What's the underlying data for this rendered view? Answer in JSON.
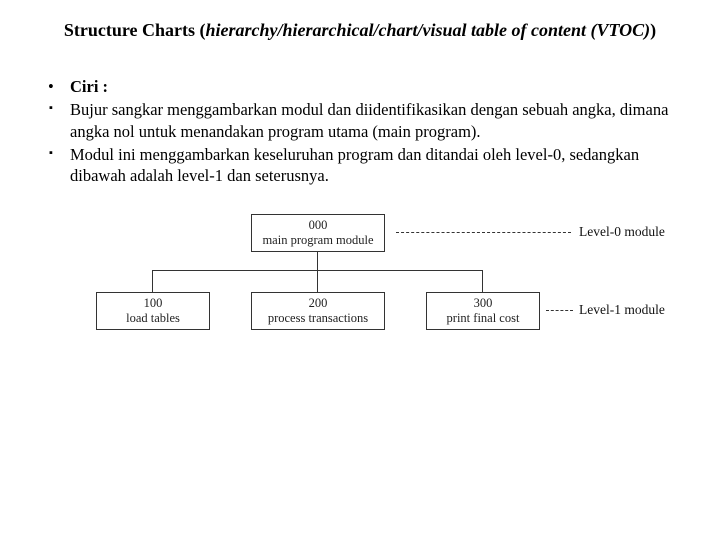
{
  "title": {
    "bold_prefix": "Structure Charts (",
    "italic_part": "hierarchy/hierarchical/chart/visual table of content (VTOC)",
    "bold_suffix": ")"
  },
  "bullets": {
    "ciri": "Ciri :",
    "b1": "Bujur sangkar menggambarkan modul dan diidentifikasikan dengan sebuah angka, dimana angka nol untuk menandakan program utama (main program).",
    "b2": "Modul ini menggambarkan keseluruhan program dan ditandai oleh level-0, sedangkan dibawah adalah level-1 dan seterusnya."
  },
  "chart_data": {
    "type": "table",
    "nodes": [
      {
        "id": "000",
        "label": "main program module",
        "level": 0
      },
      {
        "id": "100",
        "label": "load tables",
        "level": 1,
        "parent": "000"
      },
      {
        "id": "200",
        "label": "process transactions",
        "level": 1,
        "parent": "000"
      },
      {
        "id": "300",
        "label": "print final cost",
        "level": 1,
        "parent": "000"
      }
    ],
    "level_labels": {
      "0": "Level-0 module",
      "1": "Level-1 module"
    }
  },
  "boxes": {
    "n000_id": "000",
    "n000_lbl": "main program module",
    "n100_id": "100",
    "n100_lbl": "load tables",
    "n200_id": "200",
    "n200_lbl": "process transactions",
    "n300_id": "300",
    "n300_lbl": "print final cost"
  },
  "levels": {
    "l0": "Level-0 module",
    "l1": "Level-1 module"
  }
}
